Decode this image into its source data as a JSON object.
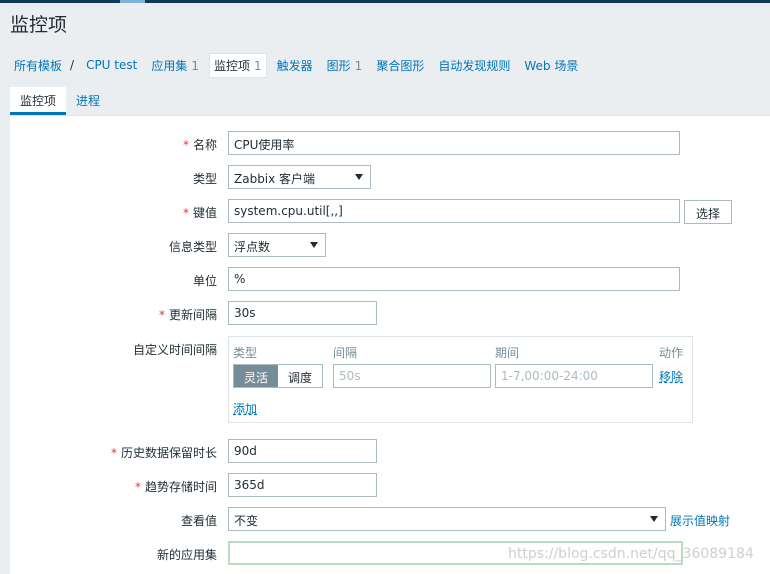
{
  "page": {
    "title": "监控项"
  },
  "breadcrumb": [
    {
      "label": "所有模板",
      "count": ""
    },
    {
      "label": "CPU test",
      "count": ""
    },
    {
      "label": "应用集",
      "count": "1"
    },
    {
      "label": "监控项",
      "count": "1"
    },
    {
      "label": "触发器",
      "count": ""
    },
    {
      "label": "图形",
      "count": "1"
    },
    {
      "label": "聚合图形",
      "count": ""
    },
    {
      "label": "自动发现规则",
      "count": ""
    },
    {
      "label": "Web 场景",
      "count": ""
    }
  ],
  "breadcrumb_sep": "/",
  "tabs": [
    {
      "label": "监控项"
    },
    {
      "label": "进程"
    }
  ],
  "form": {
    "name": {
      "label": "名称",
      "value": "CPU使用率"
    },
    "type": {
      "label": "类型",
      "value": "Zabbix 客户端"
    },
    "key": {
      "label": "键值",
      "value": "system.cpu.util[,,]",
      "select_button": "选择"
    },
    "info_type": {
      "label": "信息类型",
      "value": "浮点数"
    },
    "units": {
      "label": "单位",
      "value": "%"
    },
    "update_interval": {
      "label": "更新间隔",
      "value": "30s"
    },
    "custom_intervals": {
      "label": "自定义时间间隔",
      "col_type": "类型",
      "col_interval": "间隔",
      "col_period": "期间",
      "col_action": "动作",
      "mode_flexible": "灵活",
      "mode_scheduling": "调度",
      "interval_placeholder": "50s",
      "period_placeholder": "1-7,00:00-24:00",
      "remove": "移除",
      "add": "添加"
    },
    "history": {
      "label": "历史数据保留时长",
      "value": "90d"
    },
    "trends": {
      "label": "趋势存储时间",
      "value": "365d"
    },
    "show_value": {
      "label": "查看值",
      "value": "不变",
      "link": "展示值映射"
    },
    "new_application": {
      "label": "新的应用集",
      "value": ""
    }
  },
  "required_mark": "*",
  "watermark": "https://blog.csdn.net/qq_36089184",
  "colors": {
    "link": "#0275b8",
    "required": "#e33734",
    "header_bar": "#0e3a55"
  }
}
